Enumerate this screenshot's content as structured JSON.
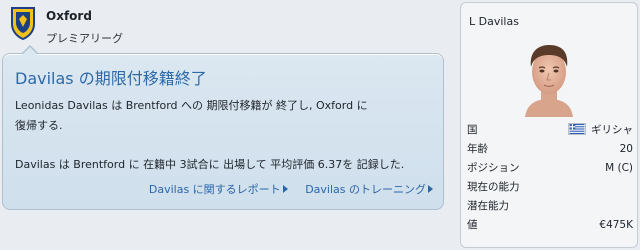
{
  "club": {
    "name": "Oxford",
    "league": "プレミアリーグ",
    "crest_icon": "club-crest-icon",
    "crest_colors": {
      "primary": "#f2c21a",
      "secondary": "#1d3f86"
    }
  },
  "news": {
    "title": "Davilas の期限付移籍終了",
    "body_lines": [
      "Leonidas Davilas は Brentford への 期限付移籍が 終了し, Oxford に",
      "復帰する."
    ],
    "stats_line": "Davilas は Brentford に 在籍中 3試合に 出場して 平均評価 6.37を 記録した.",
    "links": [
      {
        "label": "Davilas に関するレポート",
        "icon": "arrow-right-icon"
      },
      {
        "label": "Davilas のトレーニング",
        "icon": "arrow-right-icon"
      }
    ],
    "colors": {
      "title": "#2d6aa8",
      "link": "#2d66a8",
      "card": "#d6e4ef"
    }
  },
  "player": {
    "name": "L Davilas",
    "photo_icon": "player-face-icon",
    "attributes": [
      {
        "label": "国",
        "value": "ギリシャ",
        "flag": "greece-flag-icon"
      },
      {
        "label": "年齢",
        "value": "20"
      },
      {
        "label": "ポジション",
        "value": "M (C)"
      },
      {
        "label": "現在の能力",
        "value": ""
      },
      {
        "label": "潜在能力",
        "value": ""
      },
      {
        "label": "値",
        "value": "€475K"
      }
    ]
  }
}
